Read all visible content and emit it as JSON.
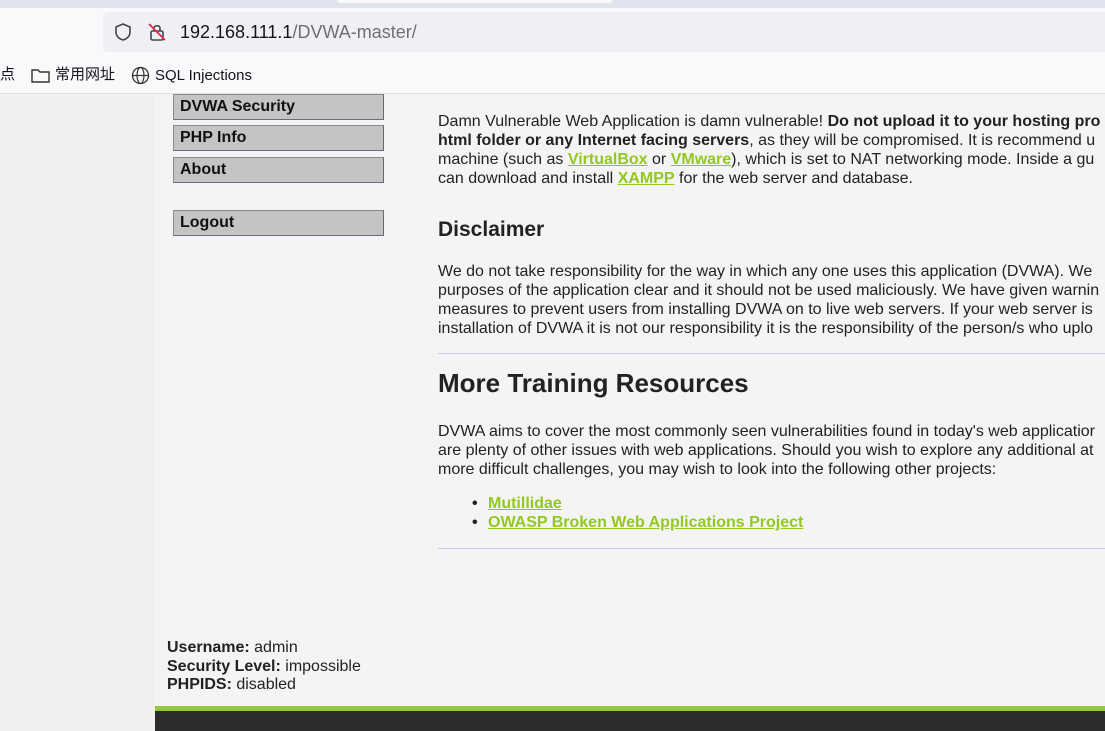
{
  "browser": {
    "url_host": "192.168.111.1",
    "url_path": "/DVWA-master/",
    "bookmarks": [
      {
        "label": "点",
        "icon": "none"
      },
      {
        "label": "常用网址",
        "icon": "folder-icon"
      },
      {
        "label": "SQL Injections",
        "icon": "globe-icon"
      }
    ]
  },
  "menu": {
    "items": [
      "DVWA Security",
      "PHP Info",
      "About"
    ],
    "logout": "Logout"
  },
  "intro": {
    "line1_a": "Damn Vulnerable Web Application is damn vulnerable! ",
    "line1_b": "Do not upload it to your hosting pro",
    "line2_a": "html folder or any Internet facing servers",
    "line2_b": ", as they will be compromised. It is recommend u",
    "line3_a": "machine (such as ",
    "line3_link1": "VirtualBox",
    "line3_b": " or ",
    "line3_link2": "VMware",
    "line3_c": "), which is set to NAT networking mode. Inside a gu",
    "line4_a": "can download and install ",
    "line4_link": "XAMPP",
    "line4_b": " for the web server and database."
  },
  "disclaimer": {
    "heading": "Disclaimer",
    "lines": [
      "We do not take responsibility for the way in which any one uses this application (DVWA). We",
      "purposes of the application clear and it should not be used maliciously. We have given warnin",
      "measures to prevent users from installing DVWA on to live web servers. If your web server is",
      "installation of DVWA it is not our responsibility it is the responsibility of the person/s who uplo"
    ]
  },
  "resources": {
    "heading": "More Training Resources",
    "lines": [
      "DVWA aims to cover the most commonly seen vulnerabilities found in today's web applicatior",
      "are plenty of other issues with web applications. Should you wish to explore any additional at",
      "more difficult challenges, you may wish to look into the following other projects:"
    ],
    "links": [
      "Mutillidae",
      "OWASP Broken Web Applications Project"
    ]
  },
  "user": {
    "username_label": "Username:",
    "username": " admin",
    "security_label": "Security Level:",
    "security": " impossible",
    "phpids_label": "PHPIDS:",
    "phpids": " disabled"
  },
  "colors": {
    "link": "#93c820",
    "footer": "#2c2c2c",
    "footer_accent": "#94c83a"
  }
}
